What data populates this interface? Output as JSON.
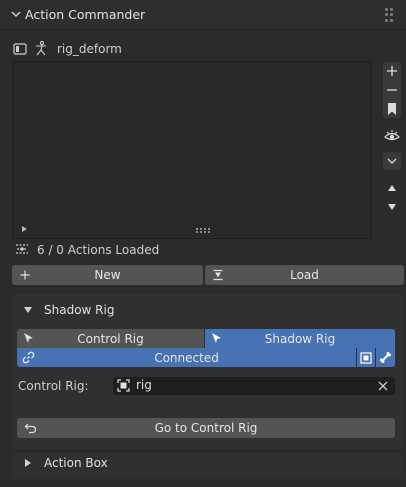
{
  "header": {
    "title": "Action Commander"
  },
  "rig": {
    "name": "rig_deform"
  },
  "status": {
    "text": "6 / 0 Actions Loaded"
  },
  "buttons": {
    "new_label": "New",
    "load_label": "Load",
    "goto_label": "Go to Control Rig"
  },
  "shadow_panel": {
    "title": "Shadow Rig",
    "tab_control": "Control Rig",
    "tab_shadow": "Shadow Rig",
    "connected_label": "Connected",
    "control_rig_label": "Control Rig:",
    "control_rig_value": "rig"
  },
  "action_box": {
    "title": "Action Box"
  },
  "colors": {
    "accent": "#4772b3",
    "button": "#545454",
    "background": "#2b2b2b"
  }
}
